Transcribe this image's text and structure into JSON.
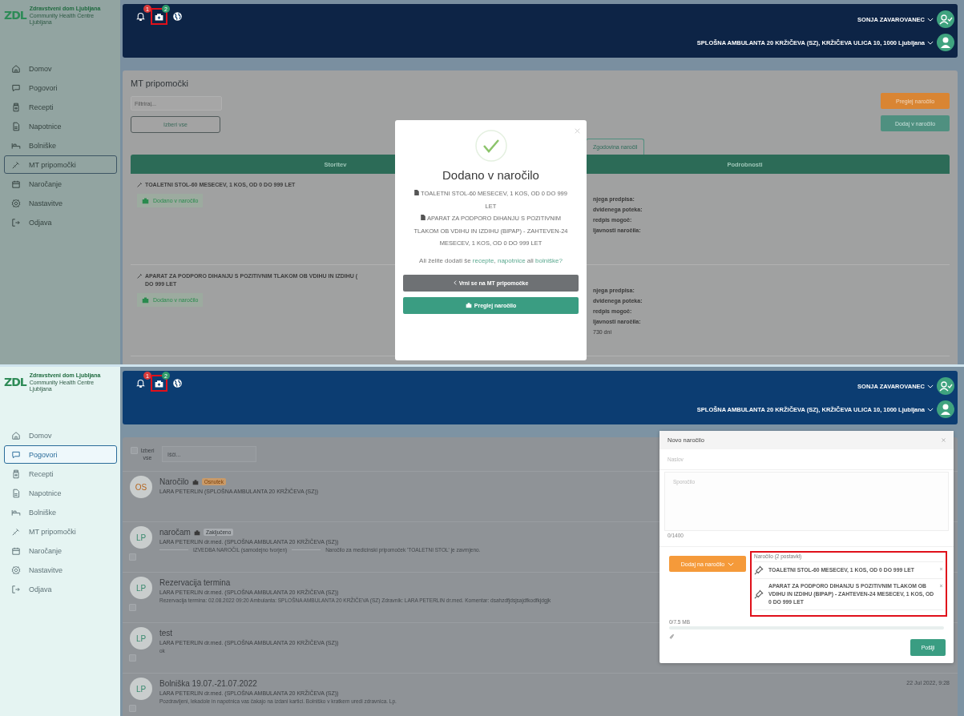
{
  "screens": [
    {
      "kind": "mt_aids",
      "logo": {
        "mark": "ZDL",
        "name": "Zdravstveni dom Ljubljana",
        "tagline": "Community Health Centre Ljubljana"
      },
      "nav": [
        {
          "label": "Domov",
          "selected": false
        },
        {
          "label": "Pogovori",
          "selected": false
        },
        {
          "label": "Recepti",
          "selected": false
        },
        {
          "label": "Napotnice",
          "selected": false
        },
        {
          "label": "Bolniške",
          "selected": false
        },
        {
          "label": "MT pripomočki",
          "selected": true
        },
        {
          "label": "Naročanje",
          "selected": false
        },
        {
          "label": "Nastavitve",
          "selected": false
        },
        {
          "label": "Odjava",
          "selected": false
        }
      ],
      "header": {
        "icons": [
          {
            "kind": "bell",
            "count": "1",
            "highlighted": false
          },
          {
            "kind": "inbox",
            "count": "2",
            "highlighted": true
          },
          {
            "kind": "globe",
            "highlighted": false
          }
        ],
        "user": "SONJA ZAVAROVANEC",
        "clinic": "SPLOŠNA AMBULANTA 20 KRŽIČEVA (SZ), KRŽIČEVA ULICA 10, 1000 Ljubljana"
      },
      "content": {
        "title": "MT pripomočki",
        "filter_placeholder": "Filtriraj...",
        "select_all": "Izberi vse",
        "actions": [
          {
            "label": "Preglej naročilo",
            "kind": "warning"
          },
          {
            "label": "Dodaj v naročilo",
            "kind": "primary"
          }
        ],
        "tab": "Zgodovina naročil",
        "columns": [
          "Storitev",
          "Podrobnosti"
        ],
        "rows": [
          {
            "lines": [
              "TOALETNI STOL-60 MESECEV, 1 KOS, OD 0 DO 999 LET"
            ],
            "status": "Dodano v naročilo",
            "details": [
              {
                "text": "njega predpisa:",
                "kind": "label"
              },
              {
                "text": "dvidenega poteka:",
                "kind": "label"
              },
              {
                "text": "redpis mogoč:",
                "kind": "label"
              },
              {
                "text": "ljavnosti naročila:",
                "kind": "label"
              }
            ]
          },
          {
            "lines": [
              "APARAT ZA PODPORO DIHANJU S POZITIVNIM TLAKOM OB VDIHU IN IZDIHU (",
              "DO 999 LET"
            ],
            "status": "Dodano v naročilo",
            "details": [
              {
                "text": "njega predpisa:",
                "kind": "label"
              },
              {
                "text": "dvidenega poteka:",
                "kind": "label"
              },
              {
                "text": "redpis mogoč:",
                "kind": "label"
              },
              {
                "text": "ljavnosti naročila:",
                "kind": "label"
              },
              {
                "text": "730 dni",
                "kind": "value"
              }
            ]
          }
        ]
      },
      "modal": {
        "title": "Dodano v naročilo",
        "items": [
          "TOALETNI STOL-60 MESECEV, 1 KOS, OD 0 DO 999 LET",
          "APARAT ZA PODPORO DIHANJU S POZITIVNIM TLAKOM OB VDIHU IN IZDIHU (BIPAP) - ZAHTEVEN-24 MESECEV, 1 KOS, OD 0 DO 999 LET"
        ],
        "question": [
          {
            "text": "Ali želite dodati še ",
            "kind": "plain"
          },
          {
            "text": "recepte",
            "kind": "link"
          },
          {
            "text": ", ",
            "kind": "plain"
          },
          {
            "text": "napotnice",
            "kind": "link"
          },
          {
            "text": " ali ",
            "kind": "plain"
          },
          {
            "text": "bolniške?",
            "kind": "link"
          }
        ],
        "back": "Vrni se na MT pripomočke",
        "primary": "Preglej naročilo"
      }
    },
    {
      "kind": "messages",
      "logo": {
        "mark": "ZDL",
        "name": "Zdravstveni dom Ljubljana",
        "tagline": "Community Health Centre Ljubljana"
      },
      "nav": [
        {
          "label": "Domov",
          "selected": false
        },
        {
          "label": "Pogovori",
          "selected": true
        },
        {
          "label": "Recepti",
          "selected": false
        },
        {
          "label": "Napotnice",
          "selected": false
        },
        {
          "label": "Bolniške",
          "selected": false
        },
        {
          "label": "MT pripomočki",
          "selected": false
        },
        {
          "label": "Naročanje",
          "selected": false
        },
        {
          "label": "Nastavitve",
          "selected": false
        },
        {
          "label": "Odjava",
          "selected": false
        }
      ],
      "header": {
        "icons": [
          {
            "kind": "bell",
            "count": "1",
            "highlighted": false
          },
          {
            "kind": "inbox",
            "count": "2",
            "highlighted": true
          },
          {
            "kind": "globe",
            "highlighted": false
          }
        ],
        "user": "SONJA ZAVAROVANEC",
        "clinic": "SPLOŠNA AMBULANTA 20 KRŽIČEVA (SZ), KRŽIČEVA ULICA 10, 1000 Ljubljana"
      },
      "content": {
        "select_all": {
          "label": "Izberi vse",
          "checked": false
        },
        "search_placeholder": "Išči...",
        "conversations": [
          {
            "initials": "OS",
            "color": "#b5651d",
            "title": "Naročilo",
            "locked": true,
            "badge": {
              "text": "Osnutek",
              "kind": "draft"
            },
            "sender": "LARA PETERLIN (SPLOŠNA AMBULANTA 20 KRŽIČEVA (SZ))"
          },
          {
            "initials": "LP",
            "color": "#3a8a6e",
            "title": "naročam",
            "locked": true,
            "badge": {
              "text": "Zaključeno",
              "kind": "closed"
            },
            "sender": "LARA PETERLIN dr.med. (SPLOŠNA AMBULANTA 20 KRŽIČEVA (SZ))",
            "checked": false,
            "preview": [
              "IZVEDBA NAROČIL (samodejno tvorjen)",
              "Naročilo za medicinski pripomoček 'TOALETNI STOL' je zavrnjeno."
            ]
          },
          {
            "initials": "LP",
            "color": "#3a8a6e",
            "title": "Rezervacija termina",
            "locked": false,
            "sender": "LARA PETERLIN dr.med. (SPLOŠNA AMBULANTA 20 KRŽIČEVA (SZ))",
            "checked": false,
            "preview": [
              "Rezervacija termina: 02.08.2022 09:20 Ambulanta: SPLOŠNA AMBULANTA 20 KRŽIČEVA (SZ) Zdravnik: LARA PETERLIN dr.med. Komentar: dsahzdfjdsjsajdfkodfkjdgjk"
            ]
          },
          {
            "initials": "LP",
            "color": "#3a8a6e",
            "title": "test",
            "locked": false,
            "sender": "LARA PETERLIN dr.med. (SPLOŠNA AMBULANTA 20 KRŽIČEVA (SZ))",
            "checked": false,
            "preview": [
              "ok"
            ]
          },
          {
            "initials": "LP",
            "color": "#3a8a6e",
            "title": "Bolniška 19.07.-21.07.2022",
            "locked": false,
            "sender": "LARA PETERLIN dr.med. (SPLOŠNA AMBULANTA 20 KRŽIČEVA (SZ))",
            "checked": false,
            "preview": [
              "Pozdravljeni, lekadole in napotnica vas čakajo na izdani kartici. Bolniško v kratkem uredi zdravnica. Lp."
            ],
            "date": "22 Jul 2022, 9:28"
          }
        ]
      },
      "modal": {
        "title": "Novo naročilo",
        "subject_placeholder": "Naslov",
        "message_placeholder": "Sporočilo",
        "counter": "0/1400",
        "add_button": "Dodaj na naročilo",
        "order": {
          "title": "Naročilo (2 postavki)",
          "highlighted": true,
          "items": [
            "TOALETNI STOL-60 MESECEV, 1 KOS, OD 0 DO 999 LET",
            "APARAT ZA PODPORO DIHANJU S POZITIVNIM TLAKOM OB VDIHU IN IZDIHU (BIPAP) - ZAHTEVEN-24 MESECEV, 1 KOS, OD 0 DO 999 LET"
          ]
        },
        "size": "0/7.5 MB",
        "send": "Pošlji"
      }
    }
  ]
}
